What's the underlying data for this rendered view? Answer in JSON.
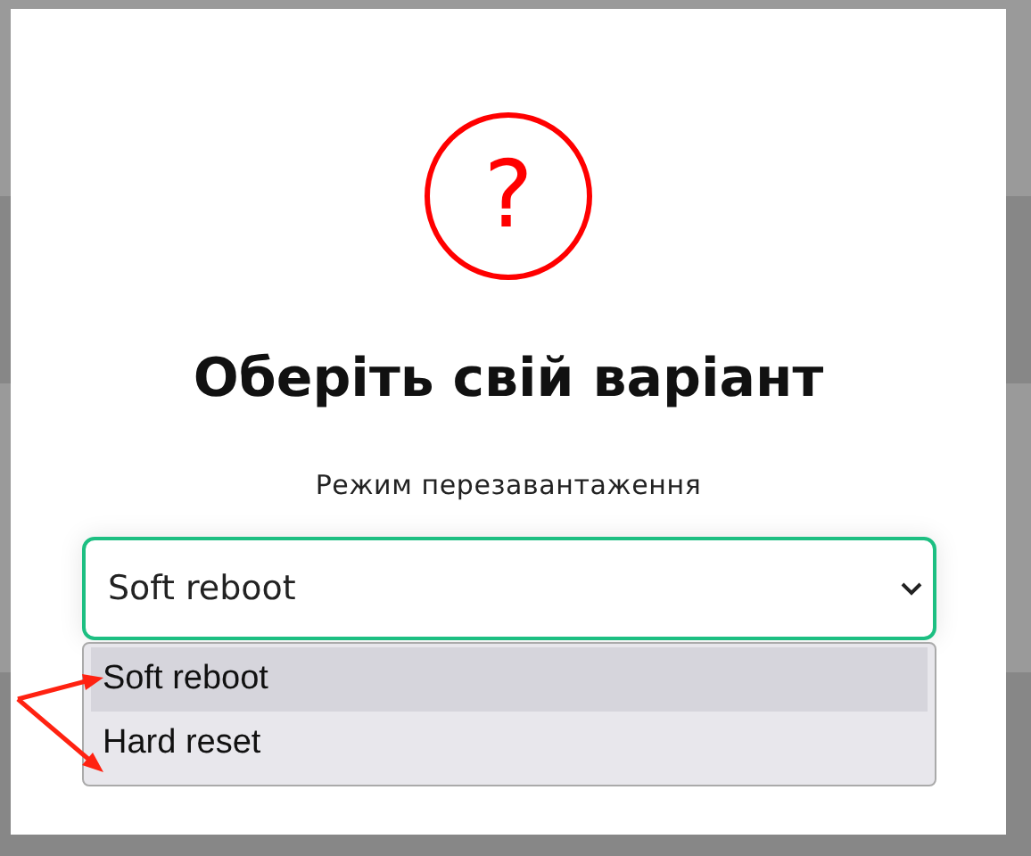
{
  "dialog": {
    "icon_text": "?",
    "title": "Оберіть свій варіант",
    "field": {
      "label": "Режим перезавантаження",
      "value": "Soft reboot",
      "expanded": true,
      "options": [
        {
          "label": "Soft reboot",
          "selected": true
        },
        {
          "label": "Hard reset",
          "selected": false
        }
      ]
    }
  }
}
